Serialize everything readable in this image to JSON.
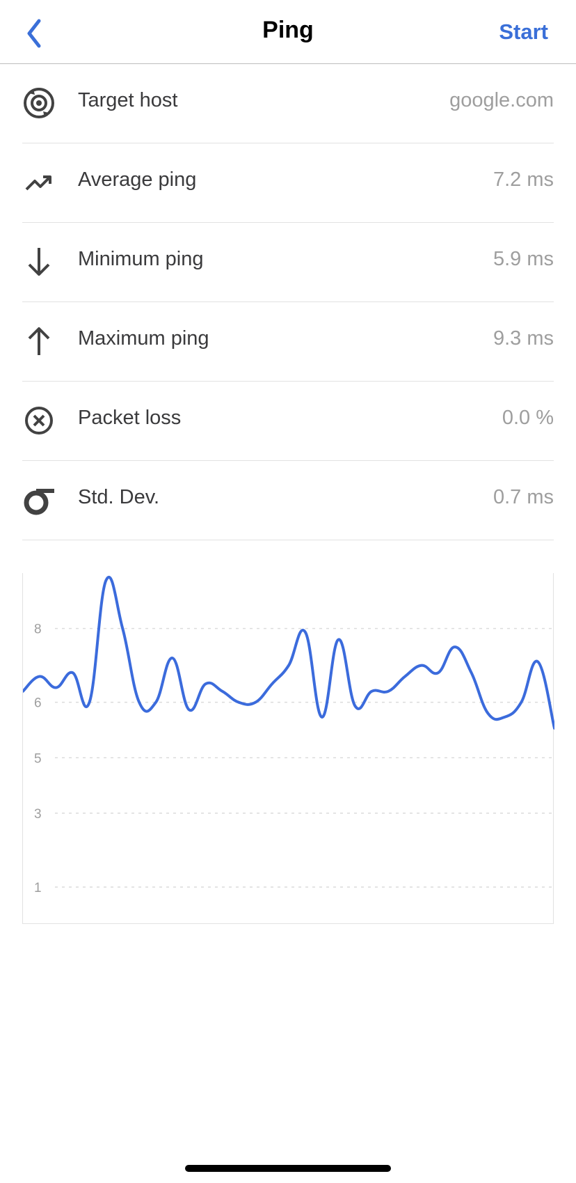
{
  "nav": {
    "title": "Ping",
    "action_label": "Start",
    "back_icon": "chevron-left-icon"
  },
  "stats": [
    {
      "icon": "target-host-icon",
      "label": "Target host",
      "value": "google.com"
    },
    {
      "icon": "trending-up-icon",
      "label": "Average ping",
      "value": "7.2 ms"
    },
    {
      "icon": "arrow-down-icon",
      "label": "Minimum ping",
      "value": "5.9 ms"
    },
    {
      "icon": "arrow-up-icon",
      "label": "Maximum ping",
      "value": "9.3 ms"
    },
    {
      "icon": "x-circle-icon",
      "label": "Packet loss",
      "value": "0.0 %"
    },
    {
      "icon": "sigma-icon",
      "label": "Std. Dev.",
      "value": "0.7 ms"
    }
  ],
  "colors": {
    "accent": "#3a6fd8",
    "line": "#3b6bdc",
    "text": "#3a3a3c",
    "muted": "#9e9e9e",
    "divider": "#e2e2e2"
  },
  "chart_data": {
    "type": "line",
    "title": "",
    "xlabel": "",
    "ylabel": "",
    "ytick_labels": [
      "8",
      "6",
      "5",
      "3",
      "1"
    ],
    "ytick_values": [
      8,
      6,
      4.5,
      3,
      1
    ],
    "ylim": [
      0,
      9.5
    ],
    "grid": true,
    "series": [
      {
        "values": [
          6.3,
          6.7,
          6.4,
          6.8,
          6.0,
          9.3,
          8.0,
          6.0,
          6.0,
          7.2,
          5.8,
          6.5,
          6.3,
          6.0,
          6.0,
          6.5,
          7.0,
          7.9,
          5.6,
          7.7,
          5.9,
          6.3,
          6.3,
          6.7,
          7.0,
          6.8,
          7.5,
          6.8,
          5.7,
          5.6,
          6.0,
          7.1,
          5.3
        ]
      }
    ]
  }
}
